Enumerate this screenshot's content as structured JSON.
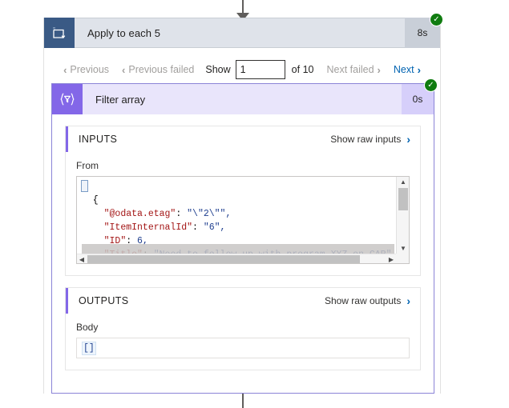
{
  "connectors": {
    "top_arrow_icon": "arrow-down-icon",
    "bottom_line_icon": "connector-line-icon"
  },
  "scope": {
    "icon": "apply-to-each-loop-icon",
    "title": "Apply to each 5",
    "duration": "8s",
    "status_icon": "success-check-icon"
  },
  "pager": {
    "previous_label": "Previous",
    "previous_failed_label": "Previous failed",
    "show_label": "Show",
    "page_value": "1",
    "page_placeholder": "1",
    "of_label": "of 10",
    "next_failed_label": "Next failed",
    "next_label": "Next",
    "chev_left": "‹",
    "chev_right": "›"
  },
  "filter": {
    "icon": "filter-array-icon",
    "title": "Filter array",
    "duration": "0s",
    "status_icon": "success-check-icon"
  },
  "inputs": {
    "title": "INPUTS",
    "raw_label": "Show raw inputs",
    "raw_chevron": "›",
    "field_label": "From",
    "code_line_1": "[",
    "code": "[\n  {\n    \"@odata.etag\": \"\\\"2\\\"\",\n    \"ItemInternalId\": \"6\",\n    \"ID\": 6,\n    \"Title\": \"Need to follow up with program XYZ on CAR\",\n    \"ORGANIZATION\": {\n      \"@odata.type\": \"#Microsoft.Azure.Connectors.SharePoint.SPLi",
    "scroll_up_icon": "▲",
    "scroll_down_icon": "▼",
    "scroll_left_icon": "◀",
    "scroll_right_icon": "▶"
  },
  "outputs": {
    "title": "OUTPUTS",
    "raw_label": "Show raw outputs",
    "raw_chevron": "›",
    "field_label": "Body",
    "body_value": "[]"
  },
  "colors": {
    "scope_icon_bg": "#3a5a85",
    "scope_header_bg": "#dfe3ea",
    "filter_icon_bg": "#8367e8",
    "filter_header_bg": "#e9e5fb",
    "accent_purple": "#8367e8",
    "success_green": "#107c10",
    "link_blue": "#0063b1",
    "json_key": "#a31515",
    "json_value": "#1f3f8f"
  }
}
